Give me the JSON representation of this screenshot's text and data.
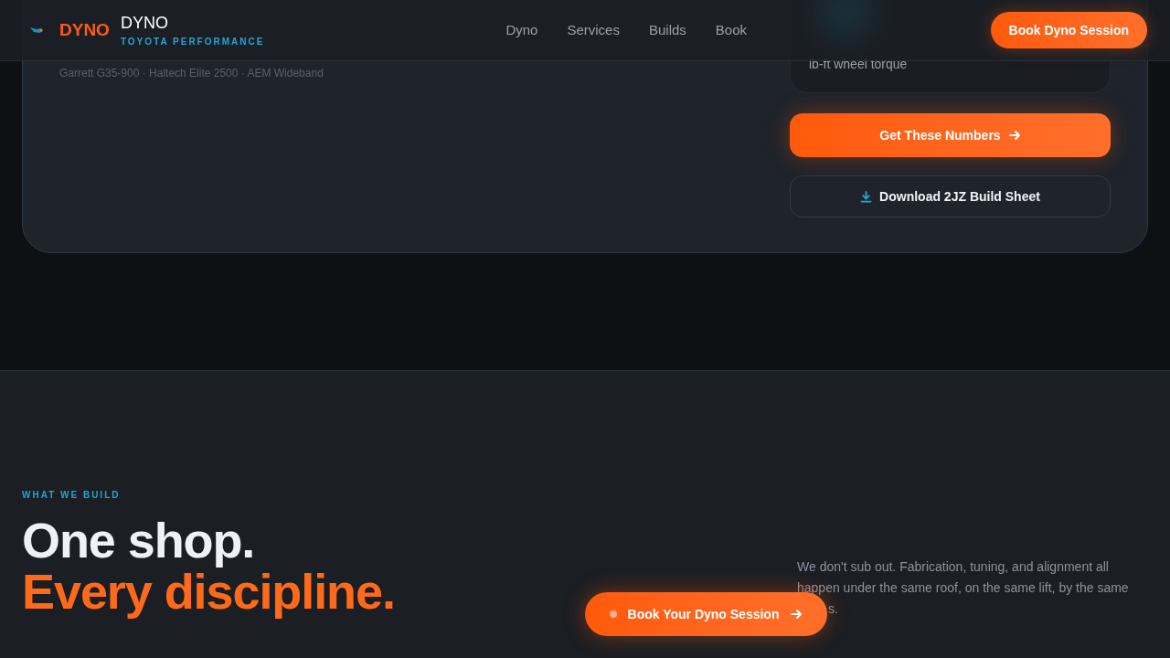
{
  "header": {
    "logo_mark": "DYNO",
    "brand": "DYNO",
    "tagline": "TOYOTA PERFORMANCE",
    "nav": [
      {
        "label": "Dyno"
      },
      {
        "label": "Services"
      },
      {
        "label": "Builds"
      },
      {
        "label": "Book"
      }
    ],
    "cta": "Book Dyno Session"
  },
  "build_card": {
    "parts": "Garrett G35-900 · Haltech Elite 2500 · AEM Wideband",
    "stat_caption": "lb-ft wheel torque",
    "primary_button": "Get These Numbers",
    "secondary_button": "Download 2JZ Build Sheet"
  },
  "services": {
    "eyebrow": "WHAT WE BUILD",
    "headline_1": "One shop.",
    "headline_2": "Every discipline.",
    "paragraph": "We don't sub out. Fabrication, tuning, and alignment all happen under the same roof, on the same lift, by the same",
    "paragraph_tail": "s."
  },
  "floating_cta": "Book Your Dyno Session"
}
